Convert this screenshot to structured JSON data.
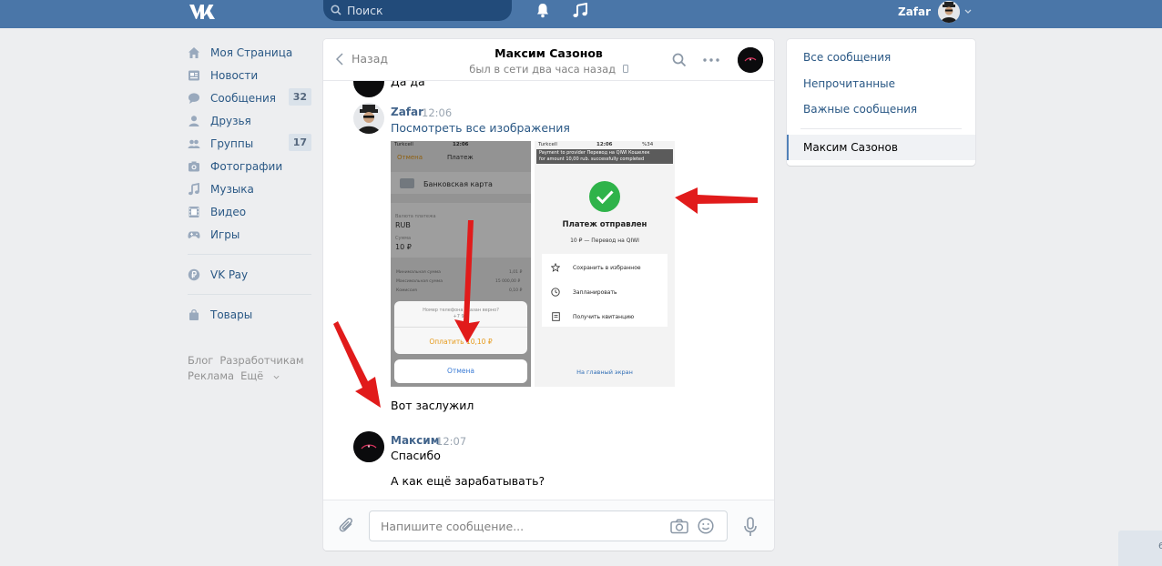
{
  "header": {
    "search_placeholder": "Поиск",
    "user_name": "Zafar",
    "brand_color": "#4a76a8"
  },
  "leftnav": {
    "items": [
      {
        "label": "Моя Страница",
        "icon": "home-icon"
      },
      {
        "label": "Новости",
        "icon": "news-icon"
      },
      {
        "label": "Сообщения",
        "icon": "messages-icon",
        "badge": "32"
      },
      {
        "label": "Друзья",
        "icon": "friends-icon"
      },
      {
        "label": "Группы",
        "icon": "groups-icon",
        "badge": "17"
      },
      {
        "label": "Фотографии",
        "icon": "photos-icon"
      },
      {
        "label": "Музыка",
        "icon": "music-icon"
      },
      {
        "label": "Видео",
        "icon": "video-icon"
      },
      {
        "label": "Игры",
        "icon": "games-icon"
      },
      {
        "label": "VK Pay",
        "icon": "vkpay-icon"
      },
      {
        "label": "Товары",
        "icon": "goods-icon"
      }
    ],
    "footer": [
      "Блог",
      "Разработчикам",
      "Реклама",
      "Ещё"
    ]
  },
  "chat": {
    "back_label": "Назад",
    "peer_name": "Максим Сазонов",
    "peer_status": "был в сети два часа назад",
    "partial_message": "Да да",
    "messages": [
      {
        "author": "Zafar",
        "time": "12:06",
        "text": "Посмотреть все изображения"
      },
      {
        "author": "",
        "time": "",
        "text": "Вот заслужил"
      },
      {
        "author": "Максим",
        "time": "12:07",
        "text": "Спасибо"
      },
      {
        "author": "",
        "time": "",
        "text": "А как ещё зарабатывать?"
      }
    ],
    "input_placeholder": "Напишите сообщение..."
  },
  "shot1": {
    "carrier": "Turkcell",
    "clock": "12:06",
    "cancel_top": "Отмена",
    "title": "Платеж",
    "card": "Банковская карта",
    "account_label": "Валюта платежа",
    "currency": "RUB",
    "sum_label": "Сумма",
    "sum": "10 ₽",
    "fee_rows": [
      [
        "Минимальная сумма",
        "1,01 ₽"
      ],
      [
        "Максимальная сумма",
        "15 000,00 ₽"
      ],
      [
        "Комиссия",
        "0,10 ₽"
      ]
    ],
    "confirm_line1": "Номер телефона указан верно?",
    "confirm_line2": "+7 9...",
    "pay_button": "Оплатить 10,10 ₽",
    "cancel_button": "Отмена"
  },
  "shot2": {
    "carrier": "Turkcell",
    "clock": "12:06",
    "battery": "%34",
    "toast_line1": "Payment to provider Перевод на QIWI Кошелек",
    "toast_line2": "for amount 10,00 rub. successfully completed",
    "title": "Платеж отправлен",
    "subtitle": "10 ₽ — Перевод на QIWI",
    "actions": [
      {
        "label": "Сохранить в избранное",
        "icon": "star-icon"
      },
      {
        "label": "Запланировать",
        "icon": "clock-icon"
      },
      {
        "label": "Получить квитанцию",
        "icon": "receipt-icon"
      }
    ],
    "home_link": "На главный экран"
  },
  "rightnav": {
    "items": [
      "Все сообщения",
      "Непрочитанные",
      "Важные сообщения"
    ],
    "active": "Максим Сазонов"
  },
  "corner_text": "6"
}
